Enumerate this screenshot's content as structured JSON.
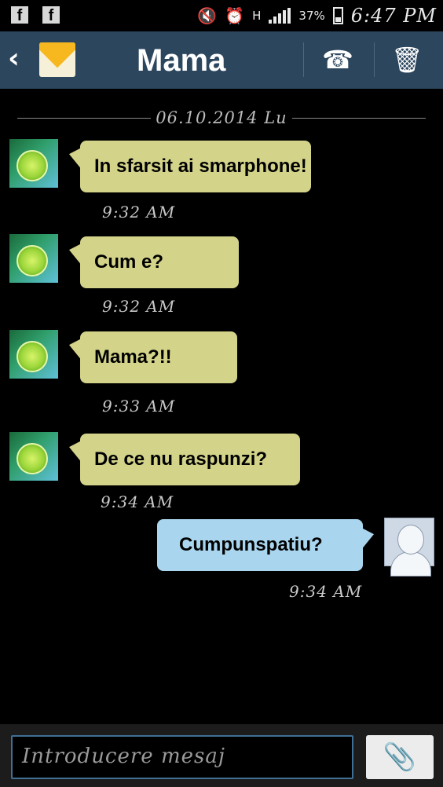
{
  "status_bar": {
    "fb_glyph": "f",
    "battery": "37%",
    "time": "6:47 PM",
    "network": "H"
  },
  "header": {
    "back_glyph": "‹",
    "title": "Mama",
    "phone_icon": "☎",
    "trash_icon": "🗑"
  },
  "conversation": {
    "date": "06.10.2014 Lu",
    "messages": [
      {
        "direction": "incoming",
        "text": "In sfarsit ai smarphone!",
        "time": "9:32 AM"
      },
      {
        "direction": "incoming",
        "text": "Cum e?",
        "time": "9:32 AM"
      },
      {
        "direction": "incoming",
        "text": "Mama?!!",
        "time": "9:33 AM"
      },
      {
        "direction": "incoming",
        "text": "De ce nu raspunzi?",
        "time": "9:34 AM"
      },
      {
        "direction": "outgoing",
        "text": "Cumpunspatiu?",
        "time": "9:34 AM"
      }
    ]
  },
  "composer": {
    "placeholder": "Introducere mesaj",
    "attach_icon": "📎"
  },
  "colors": {
    "header_bg": "#2c465e",
    "incoming_bubble": "#d3d389",
    "outgoing_bubble": "#a9d6ee",
    "input_border": "#3e6f95"
  }
}
